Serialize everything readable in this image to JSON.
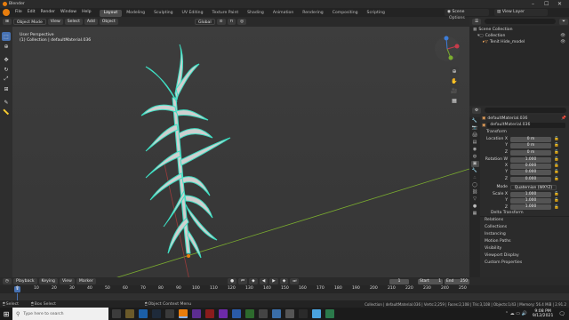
{
  "window": {
    "title": "Blender",
    "controls": [
      "–",
      "☐",
      "✕"
    ]
  },
  "menu": {
    "items": [
      "File",
      "Edit",
      "Render",
      "Window",
      "Help"
    ],
    "workspaces": [
      "Layout",
      "Modeling",
      "Sculpting",
      "UV Editing",
      "Texture Paint",
      "Shading",
      "Animation",
      "Rendering",
      "Compositing",
      "Scripting"
    ],
    "active_workspace": "Layout",
    "scene": "Scene",
    "view_layer": "View Layer"
  },
  "viewport_header": {
    "mode": "Object Mode",
    "menus": [
      "View",
      "Select",
      "Add",
      "Object"
    ],
    "orientation": "Global",
    "options_label": "Options"
  },
  "viewport": {
    "info_line1": "User Perspective",
    "info_line2": "(1) Collection | defaultMaterial.036",
    "tools": [
      "select-box",
      "cursor",
      "move",
      "rotate",
      "scale",
      "transform",
      "annotate",
      "measure"
    ]
  },
  "outliner": {
    "header_label": "Scene Collection",
    "items": [
      {
        "label": "Scene Collection"
      },
      {
        "label": "Collection"
      },
      {
        "label": "Tenit Hide_model"
      }
    ]
  },
  "properties": {
    "object_name_header": "defaultMaterial.036",
    "object_name_field": "defaultMaterial.036",
    "transform_label": "Transform",
    "location": {
      "label": "Location X",
      "y_label": "Y",
      "z_label": "Z",
      "x": "0 m",
      "y": "0 m",
      "z": "0 m"
    },
    "rotation": {
      "label": "Rotation W",
      "x_label": "X",
      "y_label": "Y",
      "z_label": "Z",
      "w": "1.000",
      "x": "0.000",
      "y": "0.000",
      "z": "0.000"
    },
    "mode": {
      "label": "Mode",
      "value": "Quaternion (WXYZ)"
    },
    "scale": {
      "label": "Scale X",
      "y_label": "Y",
      "z_label": "Z",
      "x": "1.000",
      "y": "1.000",
      "z": "1.000"
    },
    "delta_label": "Delta Transform",
    "sections": [
      "Relations",
      "Collections",
      "Instancing",
      "Motion Paths",
      "Visibility",
      "Viewport Display",
      "Custom Properties"
    ]
  },
  "timeline": {
    "menus": [
      "Playback",
      "Keying",
      "View",
      "Marker"
    ],
    "current_frame": "1",
    "start_label": "Start",
    "start": "1",
    "end_label": "End",
    "end": "250",
    "ruler": [
      "0",
      "10",
      "20",
      "30",
      "40",
      "50",
      "60",
      "70",
      "80",
      "90",
      "100",
      "110",
      "120",
      "130",
      "140",
      "150",
      "160",
      "170",
      "180",
      "190",
      "200",
      "210",
      "220",
      "230",
      "240",
      "250"
    ],
    "ruler_current": "1"
  },
  "statusbar": {
    "left1": "Select",
    "left2": "Box Select",
    "center": "Object Context Menu",
    "right": "Collection | defaultMaterial.036 | Verts:2,259 | Faces:2,108 | Tris:3,108 | Objects:1/43 | Memory: 56.4 MiB | 2.91.2"
  },
  "taskbar": {
    "search_placeholder": "Type here to search",
    "time": "9:08 PM",
    "date": "9/12/2021"
  },
  "colors": {
    "accent": "#4772b3",
    "outline": "#3fe0c4",
    "x_axis": "#c83b4a",
    "y_axis": "#7bad2f",
    "z_axis": "#3d7dd9"
  }
}
